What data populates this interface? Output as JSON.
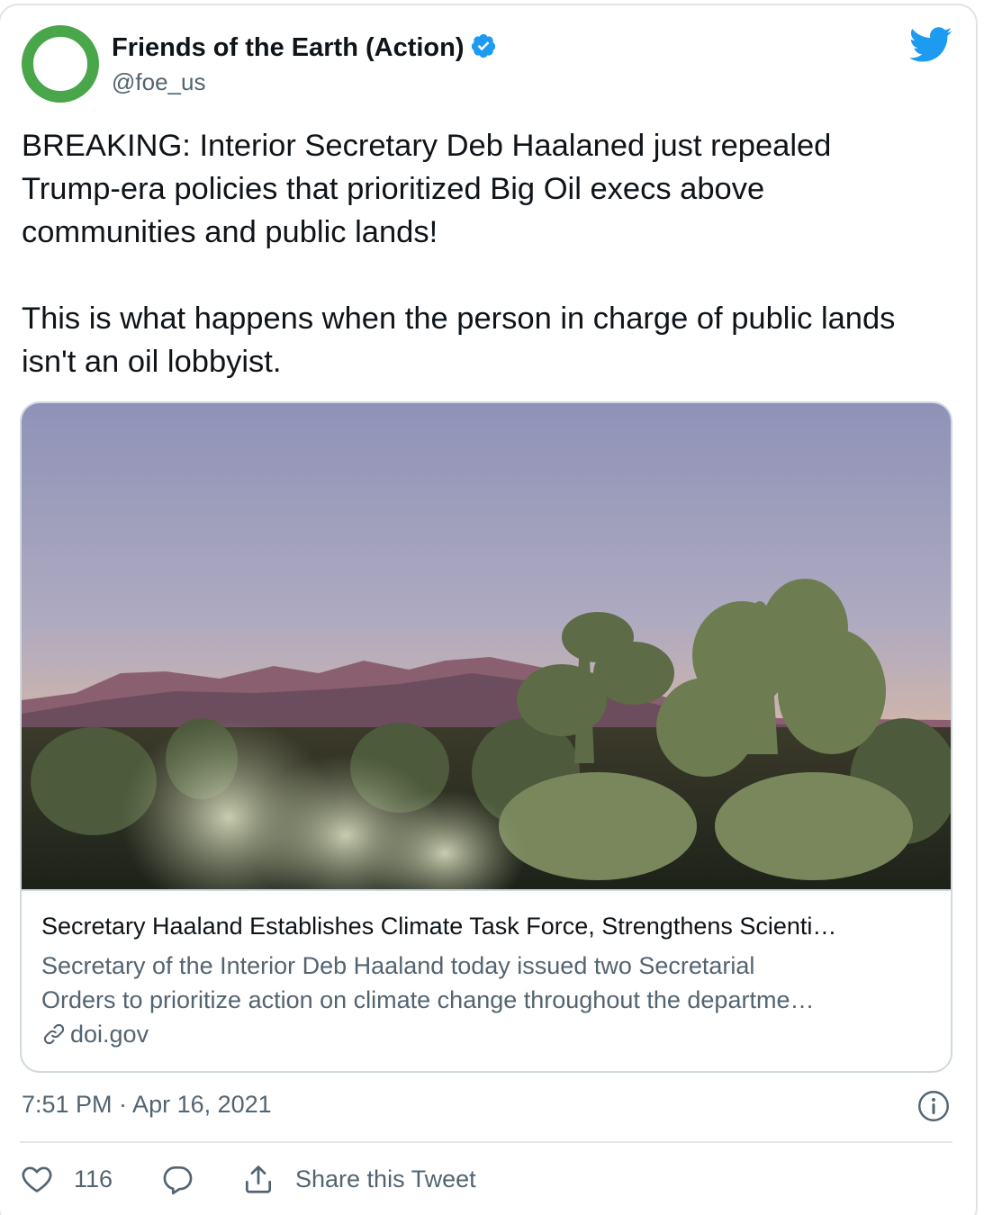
{
  "author": {
    "name": "Friends of the Earth (Action)",
    "handle": "@foe_us",
    "verified": true
  },
  "tweet": {
    "paragraph1": "BREAKING: Interior Secretary Deb Haalaned just repealed Trump-era policies that prioritized Big Oil execs above communities and public lands!",
    "paragraph2": "This is what happens when the person in charge of public lands isn't an oil lobbyist."
  },
  "link_card": {
    "image_icon": "desert-cholla-cactus-photo",
    "title": "Secretary Haaland Establishes Climate Task Force, Strengthens Scienti…",
    "description_line1": "Secretary of the Interior Deb Haaland today issued two Secretarial",
    "description_line2": "Orders to prioritize action on climate change throughout the departme…",
    "domain": "doi.gov"
  },
  "meta": {
    "timestamp": "7:51 PM · Apr 16, 2021"
  },
  "actions": {
    "like_count": "116",
    "share_label": "Share this Tweet"
  },
  "colors": {
    "brand_blue": "#1d9bf0",
    "avatar_green": "#4aa64b",
    "text_primary": "#0f1419",
    "text_secondary": "#536471",
    "border": "#cfd9de"
  }
}
